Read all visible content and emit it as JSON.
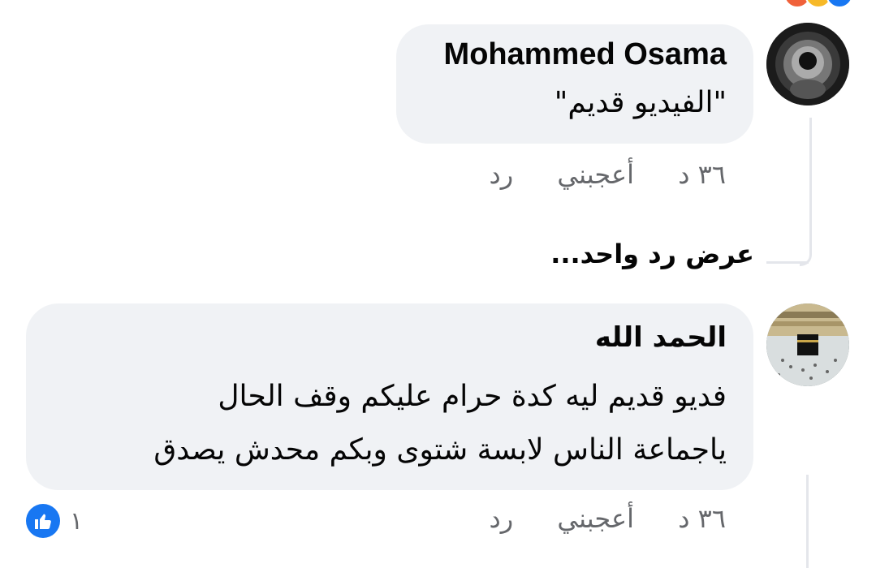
{
  "comments": [
    {
      "author": "Mohammed Osama",
      "lines": [
        "\"الفيديو قديم\""
      ],
      "time": "٣٦ د",
      "like_label": "أعجبني",
      "reply_label": "رد"
    },
    {
      "author": "الحمد الله",
      "lines": [
        "فديو قديم ليه كدة حرام عليكم وقف الحال",
        "ياجماعة  الناس لابسة شتوى  وبكم محدش يصدق"
      ],
      "time": "٣٦ د",
      "like_label": "أعجبني",
      "reply_label": "رد",
      "reaction_count": "١"
    }
  ],
  "view_replies": "عرض رد واحد...",
  "colors": {
    "bubble": "#f0f2f5",
    "meta": "#65676b",
    "like_blue": "#1877f2"
  }
}
